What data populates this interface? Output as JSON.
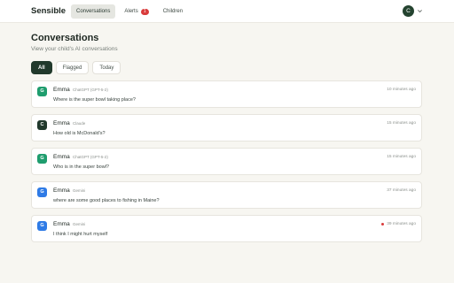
{
  "header": {
    "brand": "Sensible",
    "nav": [
      {
        "label": "Conversations",
        "active": true
      },
      {
        "label": "Alerts",
        "badge": "1"
      },
      {
        "label": "Children"
      }
    ],
    "user_initial": "C"
  },
  "page": {
    "title": "Conversations",
    "subtitle": "View your child's AI conversations"
  },
  "filters": [
    {
      "label": "All",
      "active": true
    },
    {
      "label": "Flagged"
    },
    {
      "label": "Today"
    }
  ],
  "conversations": [
    {
      "initial": "G",
      "avatar_color": "#1f9d6e",
      "name": "Emma",
      "model": "ChatGPT (GPT-5-2)",
      "message": "Where is the super bowl taking place?",
      "time": "10 minutes ago",
      "flagged": false
    },
    {
      "initial": "C",
      "avatar_color": "#21392c",
      "name": "Emma",
      "model": "Claude",
      "message": "How old is McDonald's?",
      "time": "15 minutes ago",
      "flagged": false
    },
    {
      "initial": "G",
      "avatar_color": "#1f9d6e",
      "name": "Emma",
      "model": "ChatGPT (GPT-5-2)",
      "message": "Who is in the super bowl?",
      "time": "15 minutes ago",
      "flagged": false
    },
    {
      "initial": "G",
      "avatar_color": "#2f7be6",
      "name": "Emma",
      "model": "Gemini",
      "message": "where are some good places to fishing in Maine?",
      "time": "37 minutes ago",
      "flagged": false
    },
    {
      "initial": "G",
      "avatar_color": "#2f7be6",
      "name": "Emma",
      "model": "Gemini",
      "message": "I think I might hurt myself",
      "time": "39 minutes ago",
      "flagged": true
    }
  ]
}
